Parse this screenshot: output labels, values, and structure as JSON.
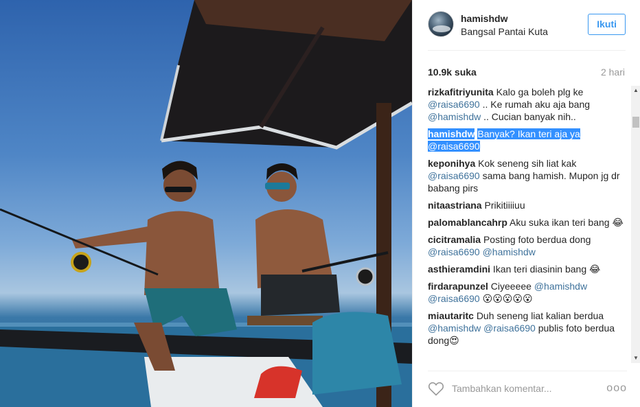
{
  "post": {
    "username": "hamishdw",
    "location": "Bangsal Pantai Kuta",
    "follow_label": "Ikuti",
    "likes": "10.9k suka",
    "time": "2 hari"
  },
  "comments": [
    {
      "user": "rizkafitriyunita",
      "parts": [
        {
          "t": "Kalo ga boleh plg ke ",
          "m": false
        },
        {
          "t": "@raisa6690",
          "m": true
        },
        {
          "t": " .. Ke rumah aku aja bang ",
          "m": false
        },
        {
          "t": "@hamishdw",
          "m": true
        },
        {
          "t": " .. Cucian banyak nih..",
          "m": false
        }
      ]
    },
    {
      "user": "hamishdw",
      "parts": [
        {
          "t": "Banyak? Ikan teri aja ya ",
          "m": false
        },
        {
          "t": "@raisa6690",
          "m": true
        }
      ]
    },
    {
      "user": "keponihya",
      "parts": [
        {
          "t": "Kok seneng sih liat kak ",
          "m": false
        },
        {
          "t": "@raisa6690",
          "m": true
        },
        {
          "t": " sama bang hamish. Mupon jg dr babang pirs",
          "m": false
        }
      ]
    },
    {
      "user": "nitaastriana",
      "parts": [
        {
          "t": "Prikitiiiiuu",
          "m": false
        }
      ]
    },
    {
      "user": "palomablancahrp",
      "parts": [
        {
          "t": "Aku suka ikan teri bang 😂",
          "m": false
        }
      ]
    },
    {
      "user": "cicitramalia",
      "parts": [
        {
          "t": "Posting foto berdua dong ",
          "m": false
        },
        {
          "t": "@raisa6690",
          "m": true
        },
        {
          "t": " ",
          "m": false
        },
        {
          "t": "@hamishdw",
          "m": true
        }
      ]
    },
    {
      "user": "asthieramdini",
      "parts": [
        {
          "t": "Ikan teri diasinin bang 😂",
          "m": false
        }
      ]
    },
    {
      "user": "firdarapunzel",
      "parts": [
        {
          "t": "Ciyeeeee ",
          "m": false
        },
        {
          "t": "@hamishdw",
          "m": true
        },
        {
          "t": " ",
          "m": false
        },
        {
          "t": "@raisa6690",
          "m": true
        },
        {
          "t": " 😮😮😮😮😮",
          "m": false
        }
      ]
    },
    {
      "user": "miautaritc",
      "parts": [
        {
          "t": "Duh seneng liat kalian berdua ",
          "m": false
        },
        {
          "t": "@hamishdw",
          "m": true
        },
        {
          "t": " ",
          "m": false
        },
        {
          "t": "@raisa6690",
          "m": true
        },
        {
          "t": " publis foto berdua dong😍",
          "m": false
        }
      ]
    }
  ],
  "footer": {
    "placeholder": "Tambahkan komentar...",
    "more_label": "ooo"
  },
  "colors": {
    "accent": "#3897f0",
    "mention": "#3f729b",
    "selection": "#3390ff"
  },
  "icons": {
    "like": "heart-icon",
    "more": "more-options-icon"
  }
}
